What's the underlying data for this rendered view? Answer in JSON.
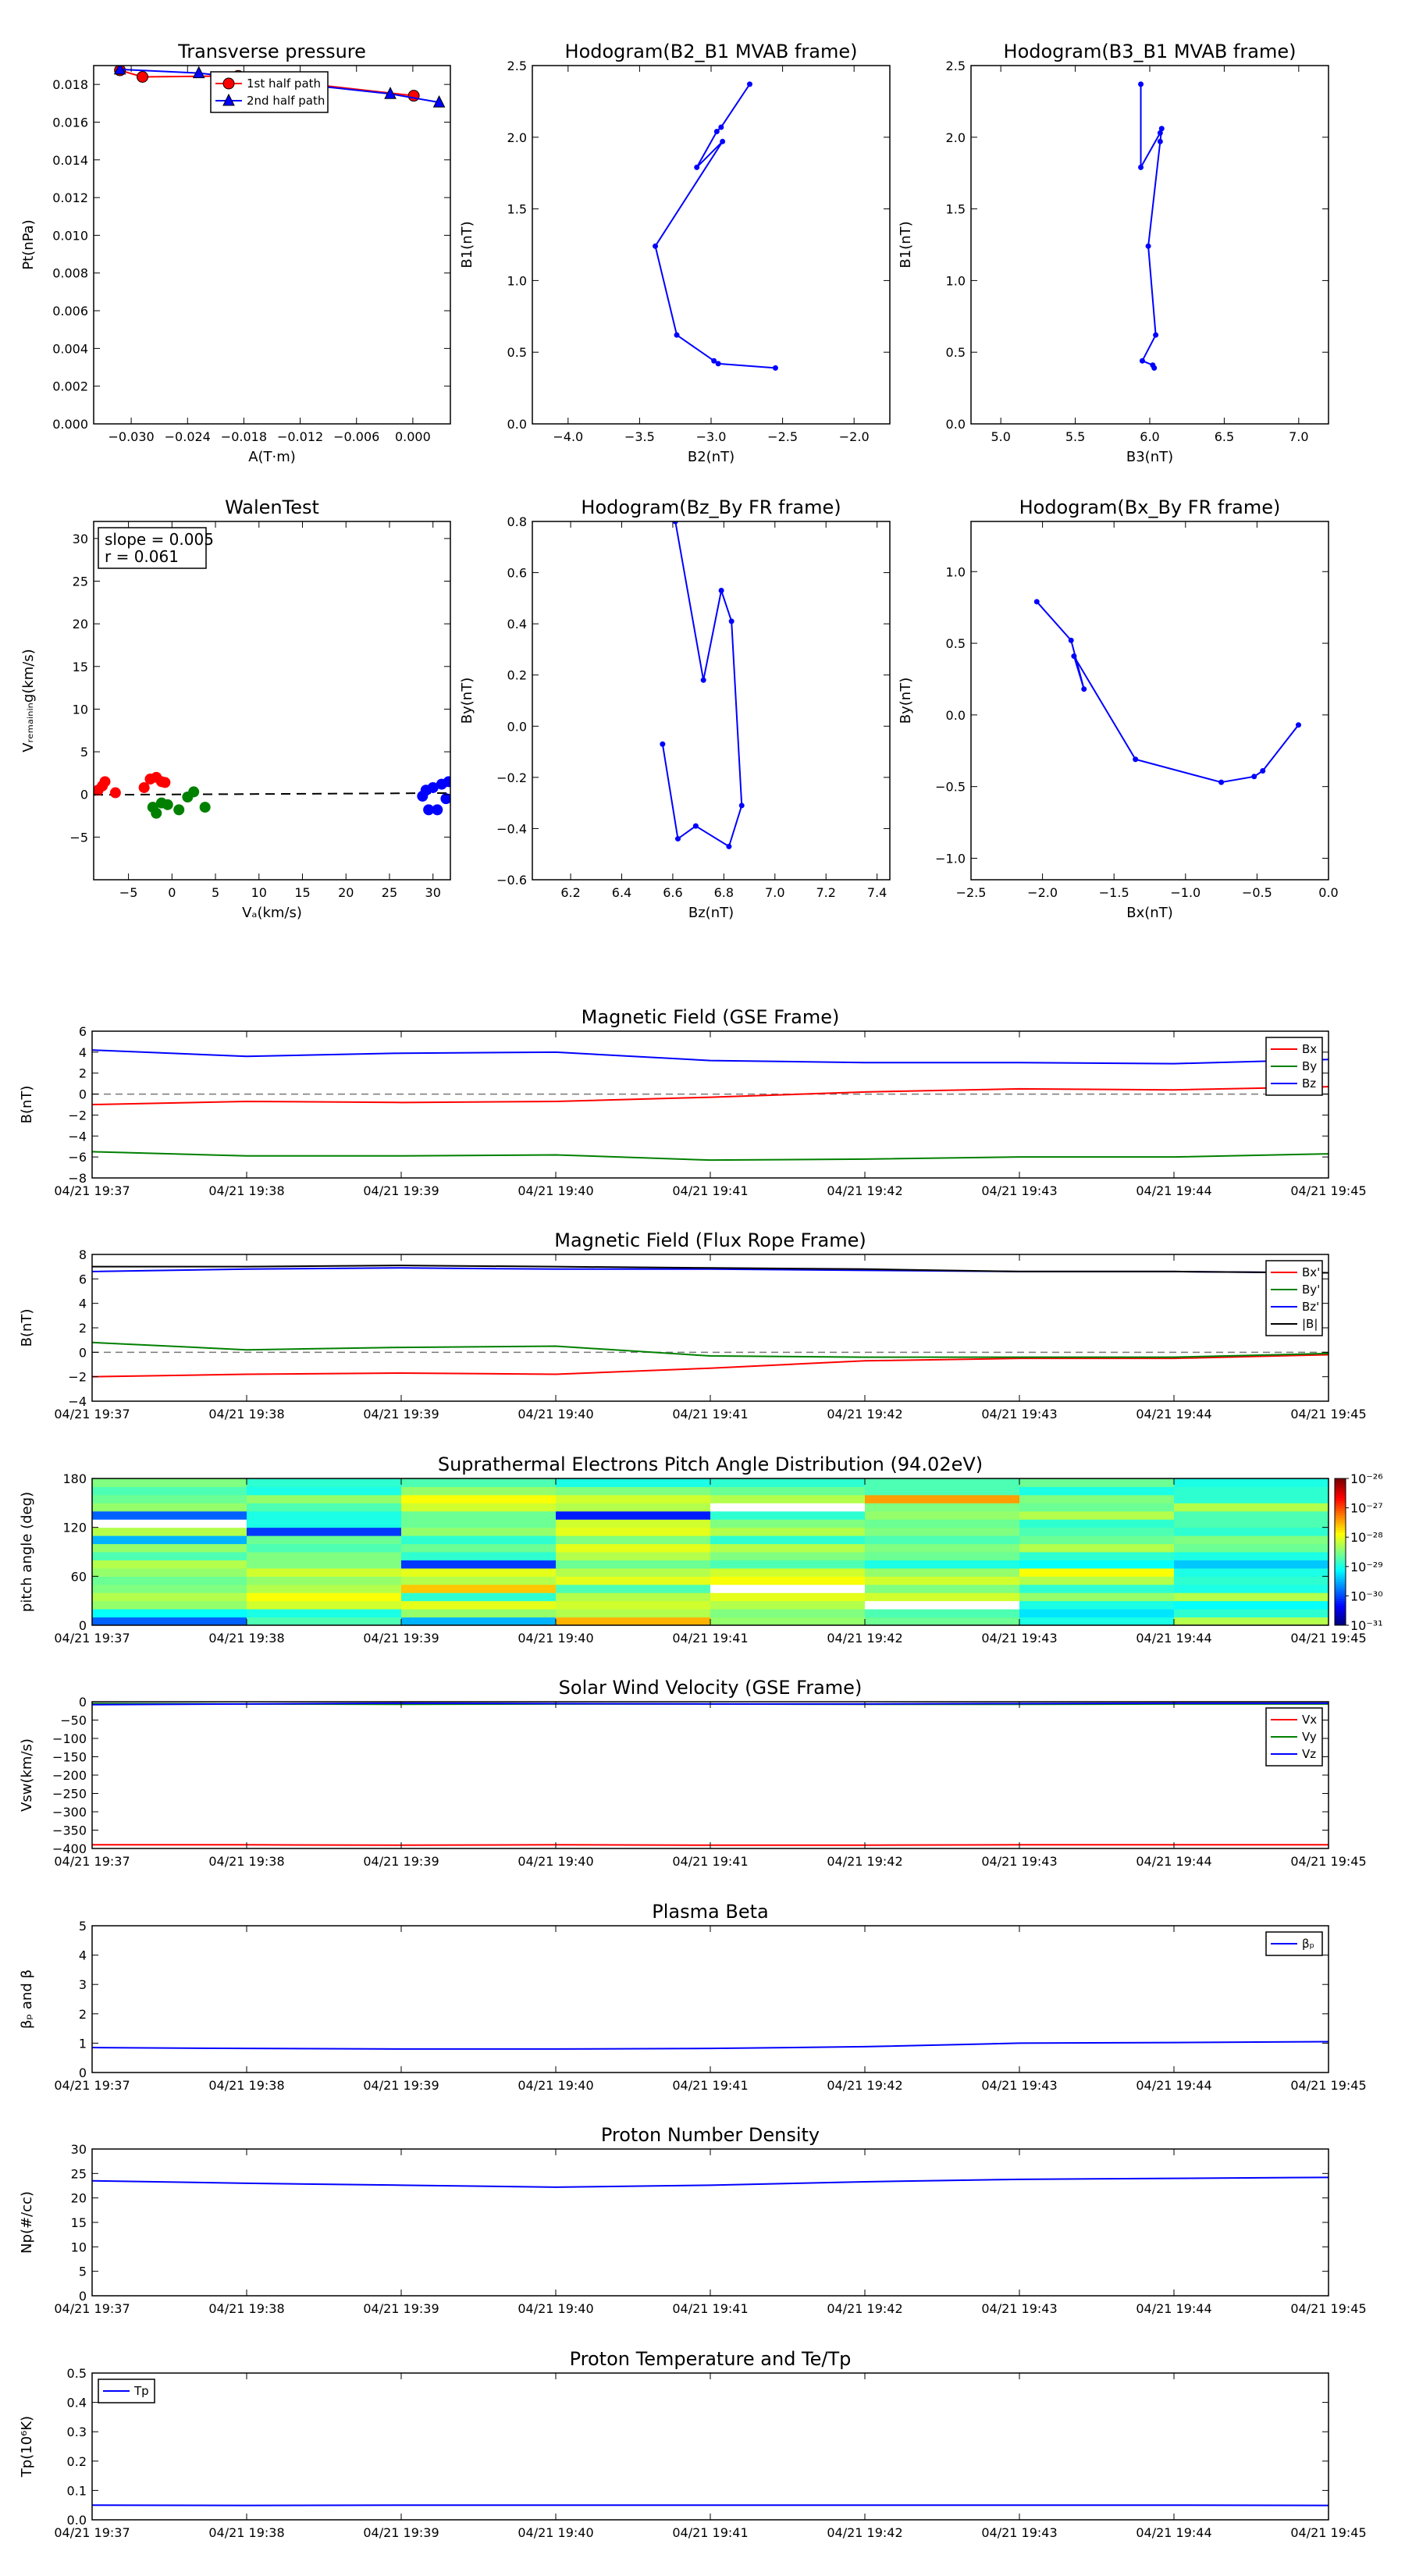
{
  "chart_data": [
    {
      "id": "pt",
      "type": "line",
      "title": "Transverse pressure",
      "xlabel": "A(T·m)",
      "ylabel": "Pt(nPa)",
      "xlim": [
        -0.034,
        0.004
      ],
      "ylim": [
        0.0,
        0.019
      ],
      "xticks": [
        -0.03,
        -0.024,
        -0.018,
        -0.012,
        -0.006,
        0.0
      ],
      "xtick_labels": [
        "−0.030",
        "−0.024",
        "−0.018",
        "−0.012",
        "−0.006",
        "0.000"
      ],
      "yticks": [
        0.0,
        0.002,
        0.004,
        0.006,
        0.008,
        0.01,
        0.012,
        0.014,
        0.016,
        0.018
      ],
      "ytick_labels": [
        "0.000",
        "0.002",
        "0.004",
        "0.006",
        "0.008",
        "0.010",
        "0.012",
        "0.014",
        "0.016",
        "0.018"
      ],
      "legend_position": "top-center",
      "series": [
        {
          "name": "1st half path",
          "color": "#ff0000",
          "marker": "circle",
          "x": [
            -0.0312,
            -0.0288,
            -0.0186,
            0.0001
          ],
          "y": [
            0.01875,
            0.0184,
            0.01845,
            0.0174
          ]
        },
        {
          "name": "2nd half path",
          "color": "#0000ff",
          "marker": "triangle",
          "x": [
            0.0028,
            -0.0024,
            -0.0228,
            -0.0312
          ],
          "y": [
            0.01705,
            0.0175,
            0.0186,
            0.0188
          ]
        }
      ]
    },
    {
      "id": "h1",
      "type": "line",
      "title": "Hodogram(B2_B1 MVAB frame)",
      "xlabel": "B2(nT)",
      "ylabel": "B1(nT)",
      "xlim": [
        -4.25,
        -1.75
      ],
      "ylim": [
        0.0,
        2.5
      ],
      "xticks": [
        -4.0,
        -3.5,
        -3.0,
        -2.5,
        -2.0
      ],
      "xtick_labels": [
        "−4.0",
        "−3.5",
        "−3.0",
        "−2.5",
        "−2.0"
      ],
      "yticks": [
        0.0,
        0.5,
        1.0,
        1.5,
        2.0,
        2.5
      ],
      "ytick_labels": [
        "0.0",
        "0.5",
        "1.0",
        "1.5",
        "2.0",
        "2.5"
      ],
      "series": [
        {
          "color": "#0000ff",
          "marker": "dot",
          "x": [
            -2.73,
            -2.93,
            -2.96,
            -3.1,
            -2.92,
            -3.39,
            -3.24,
            -2.98,
            -2.95,
            -2.55
          ],
          "y": [
            2.37,
            2.07,
            2.04,
            1.79,
            1.97,
            1.24,
            0.62,
            0.44,
            0.42,
            0.39
          ]
        }
      ]
    },
    {
      "id": "h2",
      "type": "line",
      "title": "Hodogram(B3_B1 MVAB frame)",
      "xlabel": "B3(nT)",
      "ylabel": "B1(nT)",
      "xlim": [
        4.8,
        7.2
      ],
      "ylim": [
        0.0,
        2.5
      ],
      "xticks": [
        5.0,
        5.5,
        6.0,
        6.5,
        7.0
      ],
      "xtick_labels": [
        "5.0",
        "5.5",
        "6.0",
        "6.5",
        "7.0"
      ],
      "yticks": [
        0.0,
        0.5,
        1.0,
        1.5,
        2.0,
        2.5
      ],
      "ytick_labels": [
        "0.0",
        "0.5",
        "1.0",
        "1.5",
        "2.0",
        "2.5"
      ],
      "series": [
        {
          "color": "#0000ff",
          "marker": "dot",
          "x": [
            5.94,
            5.94,
            6.07,
            6.08,
            6.07,
            5.99,
            6.04,
            5.95,
            6.02,
            6.03
          ],
          "y": [
            2.37,
            1.79,
            2.03,
            2.06,
            1.97,
            1.24,
            0.62,
            0.44,
            0.41,
            0.39
          ]
        }
      ]
    },
    {
      "id": "walen",
      "type": "scatter",
      "title": "WalenTest",
      "xlabel": "Vₐ(km/s)",
      "ylabel": "Vᵣₑₘₐᵢₙᵢₙg(km/s)",
      "xlim": [
        -9,
        32
      ],
      "ylim": [
        -10,
        32
      ],
      "xticks": [
        -5,
        0,
        5,
        10,
        15,
        20,
        25,
        30
      ],
      "xtick_labels": [
        "−5",
        "0",
        "5",
        "10",
        "15",
        "20",
        "25",
        "30"
      ],
      "yticks": [
        -5,
        0,
        5,
        10,
        15,
        20,
        25,
        30
      ],
      "ytick_labels": [
        "−5",
        "0",
        "5",
        "10",
        "15",
        "20",
        "25",
        "30"
      ],
      "annotation": [
        "slope = 0.005",
        "r = 0.061"
      ],
      "fit_line": {
        "slope": 0.005,
        "intercept": 0.0,
        "color": "#000000",
        "style": "dashed"
      },
      "series": [
        {
          "color": "#ff0000",
          "x": [
            -8.5,
            -8.0,
            -7.7,
            -6.5,
            -3.2,
            -2.5,
            -1.8,
            -1.2,
            -0.8
          ],
          "y": [
            0.5,
            1.0,
            1.5,
            0.2,
            0.8,
            1.8,
            2.0,
            1.5,
            1.4
          ]
        },
        {
          "color": "#008000",
          "x": [
            -2.2,
            -1.8,
            -1.2,
            -0.5,
            0.8,
            1.8,
            2.5,
            3.8
          ],
          "y": [
            -1.5,
            -2.2,
            -1.0,
            -1.2,
            -1.8,
            -0.3,
            0.3,
            -1.5
          ]
        },
        {
          "color": "#0000ff",
          "x": [
            28.8,
            29.2,
            29.5,
            30.0,
            30.5,
            31.0,
            31.5,
            31.8
          ],
          "y": [
            -0.2,
            0.5,
            -1.8,
            0.8,
            -1.8,
            1.2,
            -0.5,
            1.5
          ]
        }
      ]
    },
    {
      "id": "h3",
      "type": "line",
      "title": "Hodogram(Bz_By FR frame)",
      "xlabel": "Bz(nT)",
      "ylabel": "By(nT)",
      "xlim": [
        6.05,
        7.45
      ],
      "ylim": [
        -0.6,
        0.8
      ],
      "xticks": [
        6.2,
        6.4,
        6.6,
        6.8,
        7.0,
        7.2,
        7.4
      ],
      "xtick_labels": [
        "6.2",
        "6.4",
        "6.6",
        "6.8",
        "7.0",
        "7.2",
        "7.4"
      ],
      "yticks": [
        -0.6,
        -0.4,
        -0.2,
        0.0,
        0.2,
        0.4,
        0.6,
        0.8
      ],
      "ytick_labels": [
        "−0.6",
        "−0.4",
        "−0.2",
        "0.0",
        "0.2",
        "0.4",
        "0.6",
        "0.8"
      ],
      "series": [
        {
          "color": "#0000ff",
          "marker": "dot",
          "x": [
            6.61,
            6.72,
            6.79,
            6.83,
            6.87,
            6.82,
            6.69,
            6.62,
            6.56
          ],
          "y": [
            0.8,
            0.18,
            0.53,
            0.41,
            -0.31,
            -0.47,
            -0.39,
            -0.44,
            -0.07
          ]
        }
      ]
    },
    {
      "id": "h4",
      "type": "line",
      "title": "Hodogram(Bx_By FR frame)",
      "xlabel": "Bx(nT)",
      "ylabel": "By(nT)",
      "xlim": [
        -2.5,
        0.0
      ],
      "ylim": [
        -1.15,
        1.35
      ],
      "xticks": [
        -2.5,
        -2.0,
        -1.5,
        -1.0,
        -0.5,
        0.0
      ],
      "xtick_labels": [
        "−2.5",
        "−2.0",
        "−1.5",
        "−1.0",
        "−0.5",
        "0.0"
      ],
      "yticks": [
        -1.0,
        -0.5,
        0.0,
        0.5,
        1.0
      ],
      "ytick_labels": [
        "−1.0",
        "−0.5",
        "0.0",
        "0.5",
        "1.0"
      ],
      "series": [
        {
          "color": "#0000ff",
          "marker": "dot",
          "x": [
            -2.04,
            -1.8,
            -1.71,
            -1.78,
            -1.35,
            -0.75,
            -0.52,
            -0.46,
            -0.21
          ],
          "y": [
            0.79,
            0.52,
            0.18,
            0.41,
            -0.31,
            -0.47,
            -0.43,
            -0.39,
            -0.07
          ]
        }
      ]
    },
    {
      "id": "mag_gse",
      "type": "line",
      "title": "Magnetic Field (GSE Frame)",
      "xlabel": "",
      "ylabel": "B(nT)",
      "ylim": [
        -8,
        6
      ],
      "yticks": [
        -8,
        -6,
        -4,
        -2,
        0,
        2,
        4,
        6
      ],
      "ytick_labels": [
        "−8",
        "−6",
        "−4",
        "−2",
        "0",
        "2",
        "4",
        "6"
      ],
      "zero_line": true,
      "legend_position": "upper-right",
      "x_minutes": [
        0,
        1,
        2,
        3,
        4,
        5,
        6,
        7,
        8
      ],
      "series": [
        {
          "name": "Bx",
          "color": "#ff0000",
          "values": [
            -1.0,
            -0.7,
            -0.8,
            -0.7,
            -0.3,
            0.2,
            0.5,
            0.4,
            0.7
          ]
        },
        {
          "name": "By",
          "color": "#008000",
          "values": [
            -5.5,
            -5.9,
            -5.9,
            -5.8,
            -6.3,
            -6.2,
            -6.0,
            -6.0,
            -5.7
          ]
        },
        {
          "name": "Bz",
          "color": "#0000ff",
          "values": [
            4.2,
            3.6,
            3.9,
            4.0,
            3.2,
            3.0,
            3.0,
            2.9,
            3.3
          ]
        }
      ]
    },
    {
      "id": "mag_fr",
      "type": "line",
      "title": "Magnetic Field (Flux Rope Frame)",
      "xlabel": "",
      "ylabel": "B(nT)",
      "ylim": [
        -4,
        8
      ],
      "yticks": [
        -4,
        -2,
        0,
        2,
        4,
        6,
        8
      ],
      "ytick_labels": [
        "−4",
        "−2",
        "0",
        "2",
        "4",
        "6",
        "8"
      ],
      "zero_line": true,
      "legend_position": "upper-right",
      "x_minutes": [
        0,
        1,
        2,
        3,
        4,
        5,
        6,
        7,
        8
      ],
      "series": [
        {
          "name": "Bx'",
          "color": "#ff0000",
          "values": [
            -2.0,
            -1.8,
            -1.7,
            -1.8,
            -1.3,
            -0.7,
            -0.5,
            -0.5,
            -0.2
          ]
        },
        {
          "name": "By'",
          "color": "#008000",
          "values": [
            0.8,
            0.2,
            0.4,
            0.5,
            -0.3,
            -0.4,
            -0.4,
            -0.4,
            -0.1
          ]
        },
        {
          "name": "Bz'",
          "color": "#0000ff",
          "values": [
            6.6,
            6.8,
            6.9,
            6.8,
            6.8,
            6.7,
            6.6,
            6.6,
            6.5
          ]
        },
        {
          "name": "|B|",
          "color": "#000000",
          "values": [
            7.0,
            7.0,
            7.1,
            7.0,
            6.9,
            6.8,
            6.6,
            6.6,
            6.5
          ]
        }
      ]
    },
    {
      "id": "pad",
      "type": "heatmap",
      "title": "Suprathermal Electrons Pitch Angle Distribution (94.02eV)",
      "ylabel": "pitch angle (deg)",
      "ylim": [
        0,
        180
      ],
      "yticks": [
        0,
        60,
        120,
        180
      ],
      "ytick_labels": [
        "0",
        "60",
        "120",
        "180"
      ],
      "colorbar_ticks": [
        "10⁻²⁶",
        "10⁻²⁷",
        "10⁻²⁸",
        "10⁻²⁹",
        "10⁻³⁰",
        "10⁻³¹"
      ],
      "n_time_bins": 8,
      "n_angle_bins": 18,
      "values": [
        [
          0.22,
          0.45,
          0.3,
          0.7,
          0.52,
          0.48,
          0.4,
          0.55
        ],
        [
          0.38,
          0.4,
          0.52,
          0.55,
          0.5,
          0.45,
          0.35,
          0.42
        ],
        [
          0.52,
          0.58,
          0.6,
          0.58,
          0.55,
          0.02,
          0.4,
          0.38
        ],
        [
          0.55,
          0.62,
          0.42,
          0.55,
          0.6,
          0.58,
          0.52,
          0.55
        ],
        [
          0.5,
          0.55,
          0.68,
          0.45,
          0.02,
          0.5,
          0.42,
          0.4
        ],
        [
          0.48,
          0.52,
          0.55,
          0.6,
          0.62,
          0.58,
          0.55,
          0.42
        ],
        [
          0.52,
          0.58,
          0.6,
          0.55,
          0.58,
          0.52,
          0.62,
          0.4
        ],
        [
          0.55,
          0.5,
          0.18,
          0.48,
          0.45,
          0.4,
          0.38,
          0.32
        ],
        [
          0.45,
          0.5,
          0.42,
          0.55,
          0.5,
          0.48,
          0.42,
          0.4
        ],
        [
          0.52,
          0.45,
          0.48,
          0.6,
          0.55,
          0.5,
          0.55,
          0.48
        ],
        [
          0.3,
          0.48,
          0.42,
          0.5,
          0.42,
          0.45,
          0.48,
          0.5
        ],
        [
          0.55,
          0.18,
          0.52,
          0.6,
          0.55,
          0.5,
          0.45,
          0.42
        ],
        [
          0.02,
          0.4,
          0.48,
          0.58,
          0.5,
          0.48,
          0.42,
          0.45
        ],
        [
          0.22,
          0.4,
          0.48,
          0.15,
          0.42,
          0.52,
          0.55,
          0.45
        ],
        [
          0.52,
          0.45,
          0.58,
          0.55,
          0.02,
          0.5,
          0.48,
          0.55
        ],
        [
          0.48,
          0.52,
          0.62,
          0.58,
          0.55,
          0.72,
          0.5,
          0.42
        ],
        [
          0.45,
          0.4,
          0.52,
          0.5,
          0.48,
          0.45,
          0.4,
          0.42
        ],
        [
          0.5,
          0.42,
          0.45,
          0.4,
          0.42,
          0.45,
          0.48,
          0.4
        ]
      ]
    },
    {
      "id": "vsw",
      "type": "line",
      "title": "Solar Wind Velocity (GSE Frame)",
      "xlabel": "",
      "ylabel": "Vsw(km/s)",
      "ylim": [
        -400,
        0
      ],
      "yticks": [
        -400,
        -350,
        -300,
        -250,
        -200,
        -150,
        -100,
        -50,
        0
      ],
      "ytick_labels": [
        "−400",
        "−350",
        "−300",
        "−250",
        "−200",
        "−150",
        "−100",
        "−50",
        "0"
      ],
      "legend_position": "upper-right",
      "x_minutes": [
        0,
        1,
        2,
        3,
        4,
        5,
        6,
        7,
        8
      ],
      "series": [
        {
          "name": "Vx",
          "color": "#ff0000",
          "values": [
            -390,
            -390,
            -391,
            -390,
            -391,
            -391,
            -390,
            -390,
            -390
          ]
        },
        {
          "name": "Vy",
          "color": "#008000",
          "values": [
            -5,
            -6,
            -7,
            -6,
            -6,
            -7,
            -7,
            -6,
            -6
          ]
        },
        {
          "name": "Vz",
          "color": "#0000ff",
          "values": [
            -8,
            -6,
            -4,
            -5,
            -6,
            -6,
            -5,
            -4,
            -4
          ]
        }
      ]
    },
    {
      "id": "beta",
      "type": "line",
      "title": "Plasma Beta",
      "xlabel": "",
      "ylabel": "βₚ and β",
      "ylim": [
        0,
        5
      ],
      "yticks": [
        0,
        1,
        2,
        3,
        4,
        5
      ],
      "ytick_labels": [
        "0",
        "1",
        "2",
        "3",
        "4",
        "5"
      ],
      "legend_position": "upper-right",
      "x_minutes": [
        0,
        1,
        2,
        3,
        4,
        5,
        6,
        7,
        8
      ],
      "series": [
        {
          "name": "βₚ",
          "color": "#0000ff",
          "values": [
            0.85,
            0.82,
            0.8,
            0.8,
            0.82,
            0.88,
            1.0,
            1.02,
            1.05
          ]
        }
      ]
    },
    {
      "id": "np",
      "type": "line",
      "title": "Proton Number Density",
      "xlabel": "",
      "ylabel": "Np(#/cc)",
      "ylim": [
        0,
        30
      ],
      "yticks": [
        0,
        5,
        10,
        15,
        20,
        25,
        30
      ],
      "ytick_labels": [
        "0",
        "5",
        "10",
        "15",
        "20",
        "25",
        "30"
      ],
      "x_minutes": [
        0,
        1,
        2,
        3,
        4,
        5,
        6,
        7,
        8
      ],
      "series": [
        {
          "color": "#0000ff",
          "values": [
            23.5,
            23.0,
            22.6,
            22.2,
            22.6,
            23.3,
            23.8,
            24.0,
            24.2
          ]
        }
      ]
    },
    {
      "id": "tp",
      "type": "line",
      "title": "Proton Temperature and Te/Tp",
      "xlabel": "",
      "ylabel": "Tp(10⁶K)",
      "ylim": [
        0,
        0.5
      ],
      "yticks": [
        0,
        0.1,
        0.2,
        0.3,
        0.4,
        0.5
      ],
      "ytick_labels": [
        "0.0",
        "0.1",
        "0.2",
        "0.3",
        "0.4",
        "0.5"
      ],
      "legend_position": "upper-left",
      "x_minutes": [
        0,
        1,
        2,
        3,
        4,
        5,
        6,
        7,
        8
      ],
      "series": [
        {
          "name": "Tp",
          "color": "#0000ff",
          "values": [
            0.05,
            0.049,
            0.05,
            0.05,
            0.05,
            0.05,
            0.05,
            0.05,
            0.049
          ]
        }
      ]
    }
  ],
  "time_axis": {
    "labels": [
      "04/21 19:37",
      "04/21 19:38",
      "04/21 19:39",
      "04/21 19:40",
      "04/21 19:41",
      "04/21 19:42",
      "04/21 19:43",
      "04/21 19:44",
      "04/21 19:45"
    ]
  }
}
